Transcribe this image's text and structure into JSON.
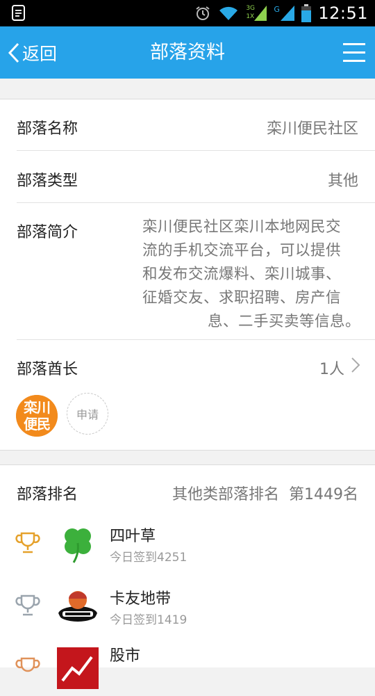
{
  "status_bar": {
    "time": "12:51",
    "network_labels": [
      "3G",
      "1X",
      "G"
    ]
  },
  "header": {
    "back_label": "返回",
    "title": "部落资料"
  },
  "profile": {
    "name_label": "部落名称",
    "name_value": "栾川便民社区",
    "type_label": "部落类型",
    "type_value": "其他",
    "intro_label": "部落简介",
    "intro_lines": [
      "栾川便民社区栾川本地网民交",
      "流的手机交流平台，可以提供",
      "和发布交流爆料、栾川城事、",
      "征婚交友、求职招聘、房产信",
      "息、二手买卖等信息。"
    ],
    "chief_label": "部落酋长",
    "chief_count": "1人",
    "chief_avatar_text": "栾川便民",
    "apply_label": "申请"
  },
  "ranking": {
    "label": "部落排名",
    "category_text": "其他类部落排名",
    "rank_text": "第1449名",
    "items": [
      {
        "name": "四叶草",
        "sub": "今日签到4251",
        "trophy": "gold",
        "icon": "clover-icon"
      },
      {
        "name": "卡友地带",
        "sub": "今日签到1419",
        "trophy": "silver",
        "icon": "card-friends-logo-icon"
      },
      {
        "name": "股市",
        "sub": "",
        "trophy": "bronze",
        "icon": "stock-market-logo-icon"
      }
    ]
  },
  "colors": {
    "accent": "#27a3e9",
    "gold": "#e5a12b",
    "silver": "#9aa4ad",
    "bronze": "#e0925a"
  }
}
